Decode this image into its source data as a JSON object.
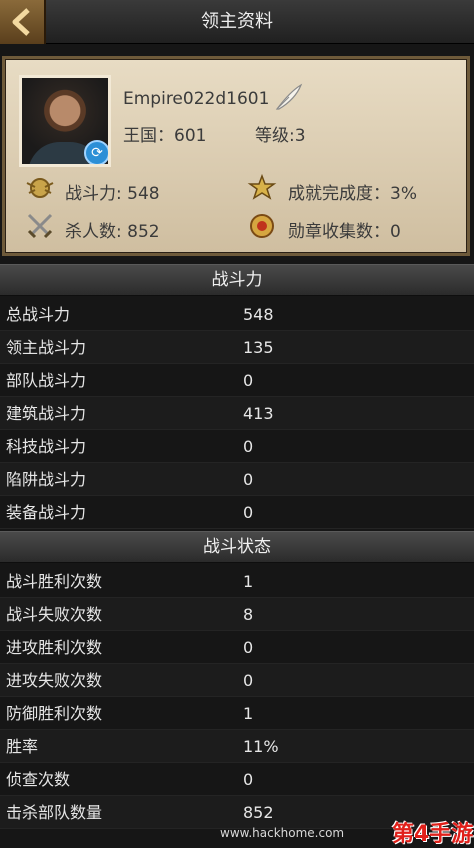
{
  "header": {
    "title": "领主资料"
  },
  "profile": {
    "name": "Empire022d1601",
    "kingdom": "王国：601",
    "level": "等级:3",
    "power": "战斗力: 548",
    "achievement": "成就完成度：3%",
    "kills": "杀人数: 852",
    "medals": "勋章收集数：0"
  },
  "sections": {
    "combat_power": {
      "title": "战斗力",
      "rows": [
        {
          "label": "总战斗力",
          "value": "548"
        },
        {
          "label": "领主战斗力",
          "value": "135"
        },
        {
          "label": "部队战斗力",
          "value": "0"
        },
        {
          "label": "建筑战斗力",
          "value": "413"
        },
        {
          "label": "科技战斗力",
          "value": "0"
        },
        {
          "label": "陷阱战斗力",
          "value": "0"
        },
        {
          "label": "装备战斗力",
          "value": "0"
        }
      ]
    },
    "combat_status": {
      "title": "战斗状态",
      "rows": [
        {
          "label": "战斗胜利次数",
          "value": "1"
        },
        {
          "label": "战斗失败次数",
          "value": "8"
        },
        {
          "label": "进攻胜利次数",
          "value": "0"
        },
        {
          "label": "进攻失败次数",
          "value": "0"
        },
        {
          "label": "防御胜利次数",
          "value": "1"
        },
        {
          "label": "胜率",
          "value": "11%"
        },
        {
          "label": "侦查次数",
          "value": "0"
        },
        {
          "label": "击杀部队数量",
          "value": "852"
        }
      ]
    }
  },
  "watermark": {
    "url": "www.hackhome.com",
    "logo": "第4手游"
  },
  "colors": {
    "accent": "#6e5a3a",
    "card_bg": "#e2d5bb",
    "logo": "#e0201a"
  },
  "icons": [
    "back-arrow-icon",
    "edit-quill-icon",
    "refresh-icon",
    "power-icon",
    "achievement-icon",
    "swords-icon",
    "medal-icon"
  ]
}
